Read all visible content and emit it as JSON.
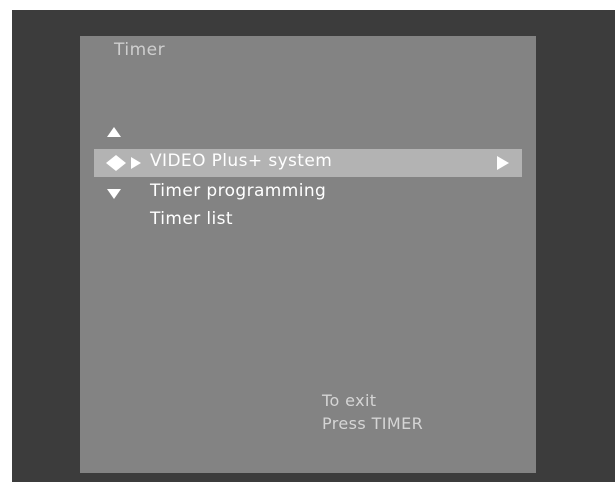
{
  "menu": {
    "title": "Timer",
    "items": [
      {
        "label": "VIDEO Plus+ system",
        "selected": true
      },
      {
        "label": "Timer programming",
        "selected": false
      },
      {
        "label": "Timer list",
        "selected": false
      }
    ]
  },
  "footer": {
    "line1": "To exit",
    "line2": "Press TIMER"
  },
  "icons": {
    "nav_up": "up-arrow-icon",
    "nav_down": "down-arrow-icon",
    "cursor": "diamond-cursor-icon",
    "selected_marker": "play-arrow-icon",
    "submenu": "submenu-arrow-icon"
  },
  "colors": {
    "frame": "#3c3c3c",
    "panel": "#838383",
    "highlight": "#b3b3b3",
    "text": "#ffffff"
  }
}
